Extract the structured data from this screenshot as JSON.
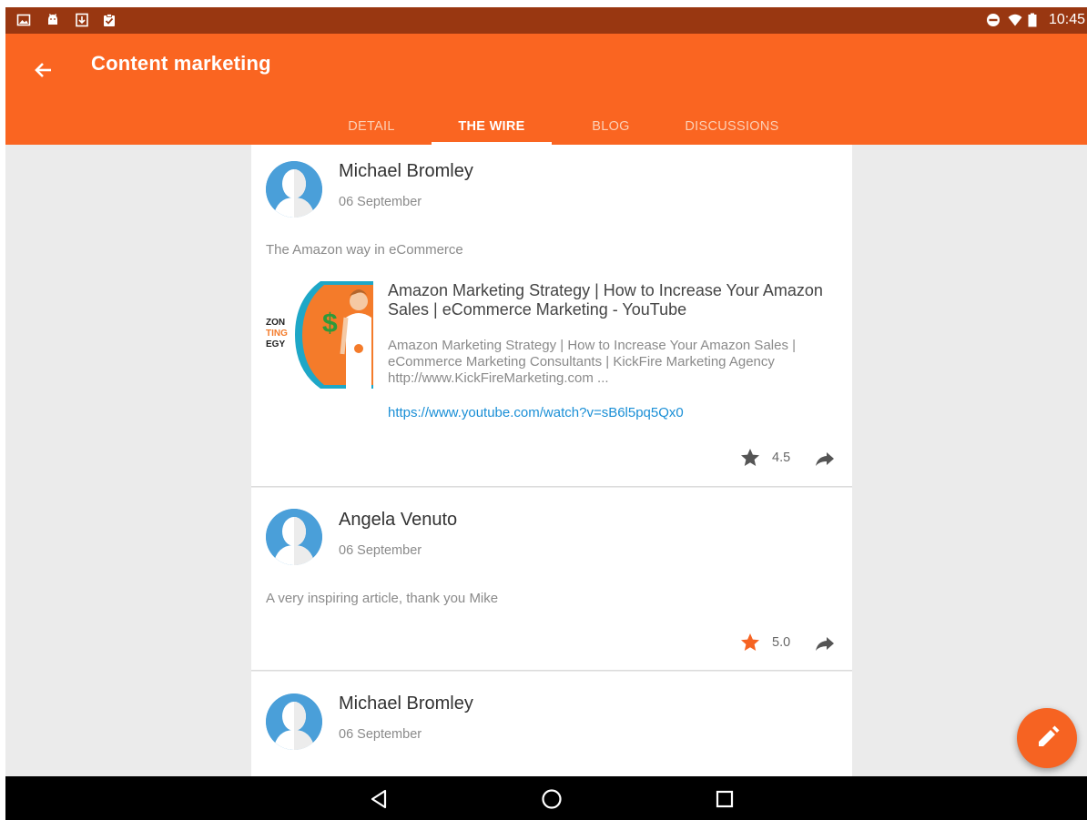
{
  "status_bar": {
    "time": "10:45",
    "left_icons": [
      "image-icon",
      "android-icon",
      "download-icon",
      "clipboard-check-icon"
    ],
    "right_icons": [
      "do-not-disturb-icon",
      "wifi-icon",
      "battery-icon"
    ]
  },
  "app_bar": {
    "title": "Content marketing",
    "back_icon": "arrow-back-icon",
    "color": "#fa6521"
  },
  "tabs": [
    {
      "label": "DETAIL",
      "active": false
    },
    {
      "label": "THE WIRE",
      "active": true
    },
    {
      "label": "BLOG",
      "active": false
    },
    {
      "label": "DISCUSSIONS",
      "active": false
    }
  ],
  "posts": [
    {
      "author": "Michael Bromley",
      "date": "06 September",
      "text": "The Amazon way in eCommerce",
      "link": {
        "thumb_text": [
          "ZON",
          "TING",
          "EGY"
        ],
        "title": "Amazon Marketing Strategy | How to Increase Your Amazon Sales | eCommerce Marketing - YouTube",
        "description": "Amazon Marketing Strategy | How to Increase Your Amazon Sales | eCommerce Marketing Consultants | KickFire Marketing Agency http://www.KickFireMarketing.com ...",
        "url": "https://www.youtube.com/watch?v=sB6l5pq5Qx0"
      },
      "rating": "4.5",
      "rated_by_user": false
    },
    {
      "author": "Angela Venuto",
      "date": "06 September",
      "text": "A very inspiring article, thank you Mike",
      "rating": "5.0",
      "rated_by_user": true
    },
    {
      "author": "Michael Bromley",
      "date": "06 September"
    }
  ],
  "fab": {
    "icon": "pencil-icon"
  },
  "nav_bar": {
    "icons": [
      "back-triangle-icon",
      "home-circle-icon",
      "recents-square-icon"
    ]
  },
  "colors": {
    "accent": "#fa6521",
    "status_bar": "#993711",
    "star_active": "#f66322",
    "star_inactive": "#555555",
    "link": "#1a8fd6",
    "avatar": "#4a9fd9"
  }
}
